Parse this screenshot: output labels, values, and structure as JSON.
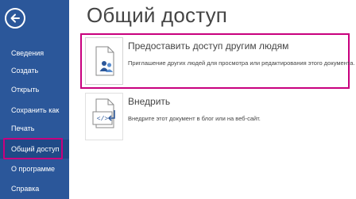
{
  "page": {
    "title": "Общий доступ"
  },
  "sidebar": {
    "items": [
      {
        "label": "Сведения"
      },
      {
        "label": "Создать"
      },
      {
        "label": "Открыть"
      },
      {
        "label": "Сохранить как"
      },
      {
        "label": "Печать"
      },
      {
        "label": "Общий доступ",
        "selected": true
      },
      {
        "label": "О программе"
      },
      {
        "label": "Справка"
      }
    ]
  },
  "options": [
    {
      "title": "Предоставить доступ другим людям",
      "description": "Приглашение других людей для просмотра или редактирования этого документа.",
      "icon": "people-document-icon",
      "highlighted": true
    },
    {
      "title": "Внедрить",
      "description": "Внедрите этот документ в блог или на веб-сайт.",
      "icon": "embed-document-icon"
    }
  ],
  "colors": {
    "sidebar": "#2b579a",
    "sidebar_selected": "#1f4a87",
    "highlight": "#c8007e"
  }
}
